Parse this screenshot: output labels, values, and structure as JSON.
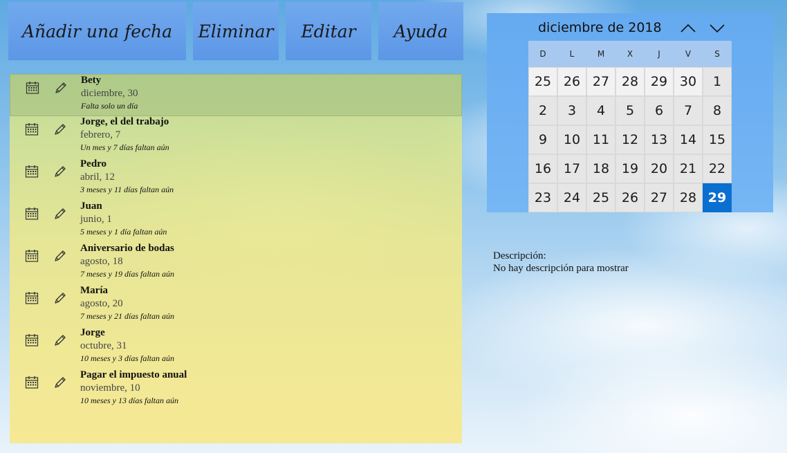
{
  "toolbar": {
    "add_label": "Añadir una fecha",
    "delete_label": "Eliminar",
    "edit_label": "Editar",
    "help_label": "Ayuda"
  },
  "dates": [
    {
      "name": "Bety",
      "date": "diciembre, 30",
      "remaining": "Falta solo un día",
      "selected": true
    },
    {
      "name": "Jorge, el del trabajo",
      "date": "febrero, 7",
      "remaining": "Un mes y 7 días faltan aún"
    },
    {
      "name": "Pedro",
      "date": "abril, 12",
      "remaining": "3 meses y 11 días faltan aún"
    },
    {
      "name": "Juan",
      "date": "junio, 1",
      "remaining": "5 meses y 1 día faltan aún"
    },
    {
      "name": "Aniversario de bodas",
      "date": "agosto, 18",
      "remaining": "7 meses y 19 días faltan aún"
    },
    {
      "name": "María",
      "date": "agosto, 20",
      "remaining": "7 meses y 21 días faltan aún"
    },
    {
      "name": "Jorge",
      "date": "octubre, 31",
      "remaining": "10 meses y 3 días faltan aún"
    },
    {
      "name": "Pagar el impuesto anual",
      "date": "noviembre, 10",
      "remaining": "10 meses y 13 días faltan aún"
    }
  ],
  "calendar": {
    "month_label": "diciembre de 2018",
    "weekdays": [
      "D",
      "L",
      "M",
      "X",
      "J",
      "V",
      "S"
    ],
    "days": [
      {
        "n": "25",
        "other": true
      },
      {
        "n": "26",
        "other": true
      },
      {
        "n": "27",
        "other": true
      },
      {
        "n": "28",
        "other": true
      },
      {
        "n": "29",
        "other": true
      },
      {
        "n": "30",
        "other": true
      },
      {
        "n": "1"
      },
      {
        "n": "2"
      },
      {
        "n": "3"
      },
      {
        "n": "4"
      },
      {
        "n": "5"
      },
      {
        "n": "6"
      },
      {
        "n": "7"
      },
      {
        "n": "8"
      },
      {
        "n": "9"
      },
      {
        "n": "10"
      },
      {
        "n": "11"
      },
      {
        "n": "12"
      },
      {
        "n": "13"
      },
      {
        "n": "14"
      },
      {
        "n": "15"
      },
      {
        "n": "16"
      },
      {
        "n": "17"
      },
      {
        "n": "18"
      },
      {
        "n": "19"
      },
      {
        "n": "20"
      },
      {
        "n": "21"
      },
      {
        "n": "22"
      },
      {
        "n": "23"
      },
      {
        "n": "24"
      },
      {
        "n": "25"
      },
      {
        "n": "26"
      },
      {
        "n": "27"
      },
      {
        "n": "28"
      },
      {
        "n": "29",
        "today": true
      }
    ],
    "nav_up_icon": "chevron-up-icon",
    "nav_down_icon": "chevron-down-icon",
    "today_color": "#0a6fd0"
  },
  "description": {
    "label": "Descripción:",
    "text": "No hay descripción para mostrar"
  }
}
